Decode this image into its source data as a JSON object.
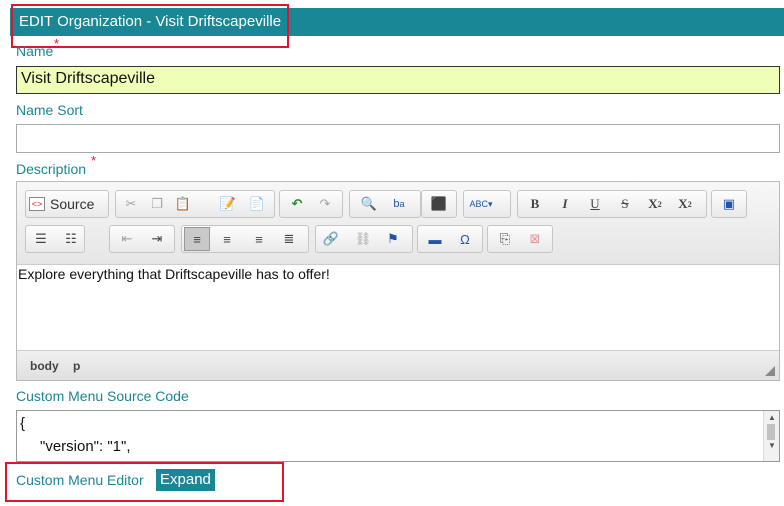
{
  "header": {
    "title": "EDIT Organization - Visit Driftscapeville"
  },
  "fields": {
    "name_label": "Name",
    "name_value": "Visit Driftscapeville",
    "name_sort_label": "Name Sort",
    "name_sort_value": "",
    "description_label": "Description",
    "required_mark": "*"
  },
  "editor": {
    "source_label": "Source",
    "toolbar_row1": [
      "cut-icon",
      "copy-icon",
      "paste-icon",
      "paste-text-icon",
      "paste-word-icon",
      "undo-icon",
      "redo-icon",
      "find-icon",
      "replace-icon",
      "select-all-icon",
      "spellcheck-icon",
      "bold-icon",
      "italic-icon",
      "underline-icon",
      "strike-icon",
      "subscript-icon",
      "superscript-icon",
      "image-icon"
    ],
    "toolbar_row2": [
      "numbered-list-icon",
      "bulleted-list-icon",
      "outdent-icon",
      "indent-icon",
      "align-left-icon",
      "align-center-icon",
      "align-right-icon",
      "justify-icon",
      "link-icon",
      "unlink-icon",
      "anchor-icon",
      "horizontal-rule-icon",
      "special-char-icon",
      "templates-icon",
      "remove-format-icon"
    ],
    "content": "Explore everything that Driftscapeville has to offer!",
    "path_body": "body",
    "path_p": "p"
  },
  "custom_menu": {
    "source_label": "Custom Menu Source Code",
    "code_line1": "{",
    "code_line2": "\"version\": \"1\",",
    "editor_label": "Custom Menu Editor",
    "expand_label": "Expand"
  },
  "colors": {
    "accent": "#1a8796",
    "required": "#e0142c",
    "highlight_input": "#f0ffb8"
  }
}
